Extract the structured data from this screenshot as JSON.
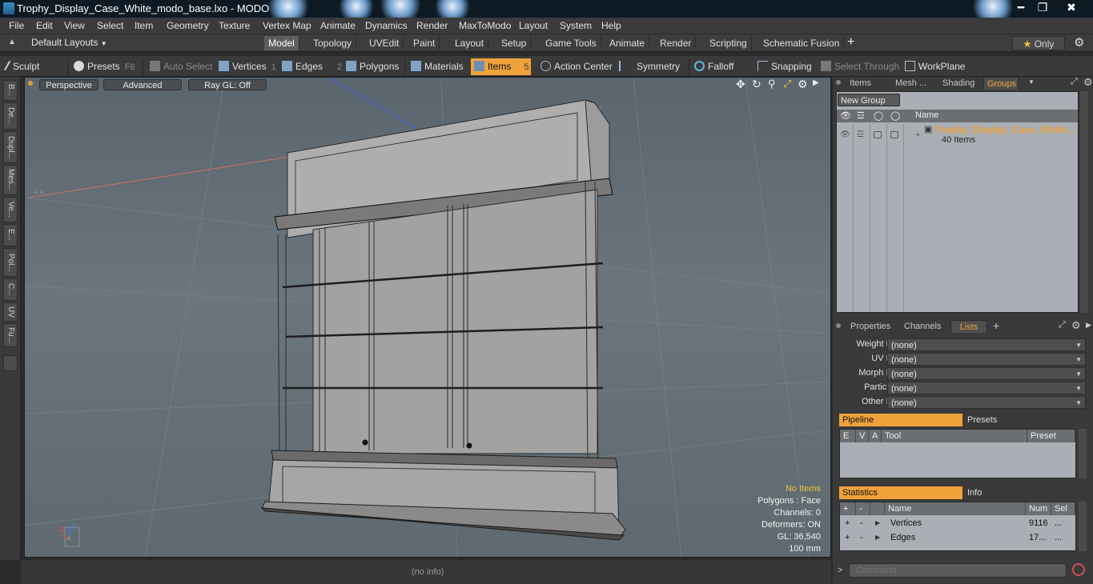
{
  "window": {
    "title": "Trophy_Display_Case_White_modo_base.lxo - MODO",
    "minimize": "━",
    "maximize": "❐",
    "close": "✖"
  },
  "menu": [
    "File",
    "Edit",
    "View",
    "Select",
    "Item",
    "Geometry",
    "Texture",
    "Vertex Map",
    "Animate",
    "Dynamics",
    "Render",
    "MaxToModo",
    "Layout",
    "System",
    "Help"
  ],
  "layoutbar": {
    "layouts_label": "Default Layouts",
    "tabs": [
      "Model",
      "Topology",
      "UVEdit",
      "Paint",
      "Layout",
      "Setup",
      "Game Tools",
      "Animate",
      "Render",
      "Scripting",
      "Schematic Fusion"
    ],
    "active_tab": "Model",
    "add": "+",
    "only_label": "Only"
  },
  "toolbar": {
    "sculpt": "Sculpt",
    "presets": "Presets",
    "presets_key": "F6",
    "auto_select": "Auto Select",
    "vertices": "Vertices",
    "vertices_count": "1",
    "edges": "Edges",
    "edges_count": "2",
    "polygons": "Polygons",
    "materials": "Materials",
    "items": "Items",
    "items_count": "5",
    "action_center": "Action Center",
    "symmetry": "Symmetry",
    "falloff": "Falloff",
    "snapping": "Snapping",
    "select_through": "Select Through",
    "workplane": "WorkPlane"
  },
  "lefttabs": [
    "B...",
    "De...",
    "Dupl...",
    "Mes...",
    "Ve...",
    "E...",
    "Pol...",
    "C...",
    "UV",
    "Fu..."
  ],
  "viewport": {
    "view_mode": "Perspective",
    "shading": "Advanced",
    "raygl": "Ray GL: Off",
    "info": {
      "no_items": "No Items",
      "polygons": "Polygons : Face",
      "channels": "Channels: 0",
      "deformers": "Deformers: ON",
      "gl": "GL: 36,540",
      "scale": "100 mm"
    },
    "axis_labels": {
      "z": "Z",
      "x": "X"
    }
  },
  "status": {
    "info": "(no info)"
  },
  "scene_panel": {
    "tabs": [
      "Items",
      "Mesh ...",
      "Shading",
      "Groups"
    ],
    "active_tab": "Groups",
    "new_group": "New Group",
    "name_header": "Name",
    "group_name": "Trophy_Display_Case_White...",
    "group_count": "40 Items"
  },
  "props_panel": {
    "tabs": [
      "Properties",
      "Channels",
      "Lists"
    ],
    "active_tab": "Lists",
    "add": "+",
    "rows": [
      {
        "label": "Weight Map",
        "value": "(none)"
      },
      {
        "label": "UV Map",
        "value": "(none)"
      },
      {
        "label": "Morph Map",
        "value": "(none)"
      },
      {
        "label": "Particle ...",
        "value": "(none)"
      },
      {
        "label": "Other Map",
        "value": "(none)"
      }
    ]
  },
  "pipeline": {
    "tab": "Pipeline",
    "presets_tab": "Presets",
    "headers": [
      "E",
      "V",
      "A",
      "Tool",
      "Preset"
    ]
  },
  "statistics": {
    "tab": "Statistics",
    "info_tab": "Info",
    "headers": {
      "plus": "+",
      "minus": "-",
      "name": "Name",
      "num": "Num",
      "sel": "Sel"
    },
    "rows": [
      {
        "plus": "+",
        "minus": "-",
        "name": "Vertices",
        "num": "9116",
        "sel": "..."
      },
      {
        "plus": "+",
        "minus": "-",
        "name": "Edges",
        "num": "17...",
        "sel": "..."
      }
    ]
  },
  "command": {
    "prompt": ">",
    "placeholder": "Command"
  }
}
